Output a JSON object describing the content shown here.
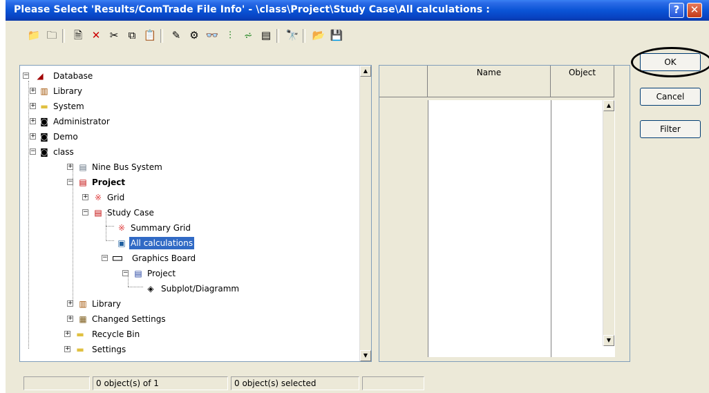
{
  "window": {
    "title": "Please Select 'Results/ComTrade File Info' - \\class\\Project\\Study Case\\All calculations :",
    "help_label": "?",
    "close_label": "✕"
  },
  "toolbar": {
    "icons": [
      "folder-up-icon",
      "folder-icon",
      "new-object-icon",
      "delete-icon",
      "cut-icon",
      "copy-icon",
      "paste-icon",
      "edit-icon",
      "settings-icon",
      "view-icon",
      "filter-icon",
      "chart-icon",
      "detail-icon",
      "find-icon",
      "open-icon",
      "save-icon"
    ]
  },
  "tree": {
    "nodes": [
      {
        "label": "Database",
        "expander": "⊟",
        "icon": "◢"
      },
      {
        "label": "Library",
        "expander": "⊞",
        "icon": "▥"
      },
      {
        "label": "System",
        "expander": "⊞",
        "icon": "▬"
      },
      {
        "label": "Administrator",
        "expander": "⊞",
        "icon": "◙"
      },
      {
        "label": "Demo",
        "expander": "⊞",
        "icon": "◙"
      },
      {
        "label": "class",
        "expander": "⊟",
        "icon": "◙"
      },
      {
        "label": "Nine Bus System",
        "expander": "⊞",
        "icon": "▤"
      },
      {
        "label": "Project",
        "expander": "⊟",
        "icon": "▤"
      },
      {
        "label": "Grid",
        "expander": "⊞",
        "icon": "※"
      },
      {
        "label": "Study Case",
        "expander": "⊟",
        "icon": "▤"
      },
      {
        "label": "Summary Grid",
        "expander": "",
        "icon": "※"
      },
      {
        "label": "All calculations",
        "expander": "",
        "icon": "▣"
      },
      {
        "label": "Graphics Board",
        "expander": "⊟",
        "icon": "▭"
      },
      {
        "label": "Project",
        "expander": "⊟",
        "icon": "▤"
      },
      {
        "label": "Subplot/Diagramm",
        "expander": "",
        "icon": "◈"
      },
      {
        "label": "Library",
        "expander": "⊞",
        "icon": "▥"
      },
      {
        "label": "Changed Settings",
        "expander": "⊞",
        "icon": "▦"
      },
      {
        "label": "Recycle Bin",
        "expander": "⊞",
        "icon": "▬"
      },
      {
        "label": "Settings",
        "expander": "⊞",
        "icon": "▬"
      }
    ]
  },
  "grid": {
    "columns": [
      "Name",
      "Object"
    ]
  },
  "buttons": {
    "ok": "OK",
    "cancel": "Cancel",
    "filter": "Filter"
  },
  "status": {
    "count": "0 object(s) of 1",
    "selected": "0 object(s) selected"
  },
  "colors": {
    "title_bar": "#0a54d6",
    "selection": "#316ac5",
    "dialog_bg": "#ece9d8"
  }
}
